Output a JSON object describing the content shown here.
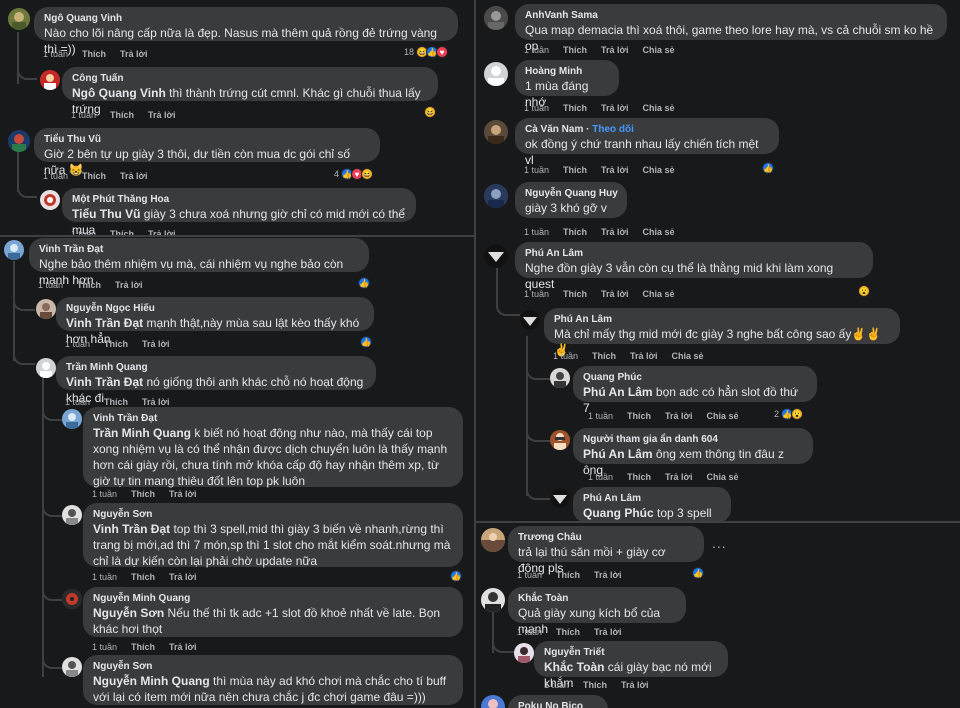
{
  "labels": {
    "time": "1 tuần",
    "like": "Thích",
    "reply": "Trả lời",
    "share": "Chia sẻ",
    "more": "..."
  },
  "panel_a": {
    "c1": {
      "name": "Ngô Quang Vinh",
      "text": "Nào cho lõi nâng cấp nữa là đẹp. Nasus mà thêm quả rồng đẻ trứng vàng thì =))",
      "react_count": "18"
    },
    "c2": {
      "name": "Công Tuấn",
      "mention": "Ngô Quang Vinh",
      "text": " thì thành trứng cút cmnl. Khác gì chuỗi thua lấy trứng"
    },
    "c3": {
      "name": "Tiểu Thu Vũ",
      "text": "Giờ 2 bên tự up giày 3 thôi, dư tiền còn mua dc gói chỉ số nữa 😸",
      "react_count": "4"
    },
    "c4": {
      "name": "Một Phút Thăng Hoa",
      "mention": "Tiểu Thu Vũ",
      "text": " giày 3 chưa xoá nhưng giờ chỉ có mid mới có thể mua"
    }
  },
  "panel_b": {
    "c1": {
      "name": "Vinh Trần Đạt",
      "text": "Nghe bảo thêm nhiệm vụ mà, cái nhiệm vụ nghe bảo còn mạnh hơn"
    },
    "c2": {
      "name": "Nguyễn Ngọc Hiếu",
      "mention": "Vinh Trần Đạt",
      "text": " mạnh thật,này mùa sau lật kèo thấy khó hơn hẳn"
    },
    "c3": {
      "name": "Trần Minh Quang",
      "mention": "Vinh Trần Đạt",
      "text": " nó giống thôi anh khác chỗ nó hoạt động khác đi"
    },
    "c4": {
      "name": "Vinh Trần Đạt",
      "mention": "Trần Minh Quang",
      "text": " k biết nó hoạt động như nào, mà thấy cái top xong nhiệm vụ là có thể nhận được dịch chuyển luôn là thấy mạnh hơn cái giày rồi, chưa tính mở khóa cấp độ hay nhận thêm xp, từ giờ tự tin mang thiêu đốt lên top pk luôn"
    },
    "c5": {
      "name": "Nguyễn Sơn",
      "mention": "Vinh Trần Đạt",
      "text": " top thì 3 spell,mid thì giày 3 biến về nhanh,rừng thì trang bị mới,ad thì 7 món,sp thì 1 slot cho mắt kiểm soát.nhưng mà chỉ là dự kiến còn lại phải chờ update nữa"
    },
    "c6": {
      "name": "Nguyễn Minh Quang",
      "mention": "Nguyễn Sơn",
      "text": " Nếu thế thì tk adc +1 slot đồ khoẻ nhất về late. Bọn khác hơi thọt"
    },
    "c7": {
      "name": "Nguyễn Sơn",
      "mention": "Nguyễn Minh Quang",
      "text": " thì mùa này ad khó chơi mà chắc cho tí buff với lại có item mới nữa nên chưa chắc j đc chơi game đâu =)))"
    }
  },
  "panel_c": {
    "c1": {
      "name": "AnhVanh Sama",
      "text": "Qua map demacia thì xoá thôi, game theo lore hay mà, vs cả chuỗi sm ko hề op"
    },
    "c2": {
      "name": "Hoàng Minh",
      "text": "1 mùa đáng nhớ"
    },
    "c3": {
      "name": "Cà Văn Nam",
      "follow": "Theo dõi",
      "text": "ok đồng ý chứ tranh nhau lấy chiến tích mệt vl"
    },
    "c4": {
      "name": "Nguyễn Quang Huy",
      "text": "giày 3 khó gỡ v"
    },
    "c5": {
      "name": "Phú An Lâm",
      "text": "Nghe đồn giày 3 vẫn còn cụ thể là thằng mid khi làm xong quest"
    },
    "c6": {
      "name": "Phú An Lâm",
      "text": "Mà chỉ mấy thg mid mới đc giày 3 nghe bất công sao ấy✌️✌️✌️"
    },
    "c7": {
      "name": "Quang Phúc",
      "mention": "Phú An Lâm",
      "text": " bọn adc có hẳn slot đồ thứ 7",
      "react_count": "2"
    },
    "c8": {
      "name": "Người tham gia ẩn danh 604",
      "mention": "Phú An Lâm",
      "text": " ông xem thông tin đâu z ông"
    },
    "c9": {
      "name": "Phú An Lâm",
      "mention": "Quang Phúc",
      "text": " top 3 spell✌️"
    }
  },
  "panel_d": {
    "c1": {
      "name": "Trương Châu",
      "text": "trả lại thú săn mồi + giày cơ động pls"
    },
    "c2": {
      "name": "Khắc Toàn",
      "text": "Quả giày xung kích bổ của mạnh"
    },
    "c3": {
      "name": "Nguyễn Triết",
      "mention": "Khắc Toàn",
      "text": " cái giày bạc nó mới khắm"
    },
    "c4": {
      "name": "Poku No Bico"
    }
  },
  "colors": {
    "background": "#18191a",
    "bubble": "#3a3b3c",
    "text": "#e4e6eb",
    "muted": "#b0b3b8",
    "link": "#4599ff",
    "like": "#1877f2",
    "heart": "#f33e58"
  }
}
